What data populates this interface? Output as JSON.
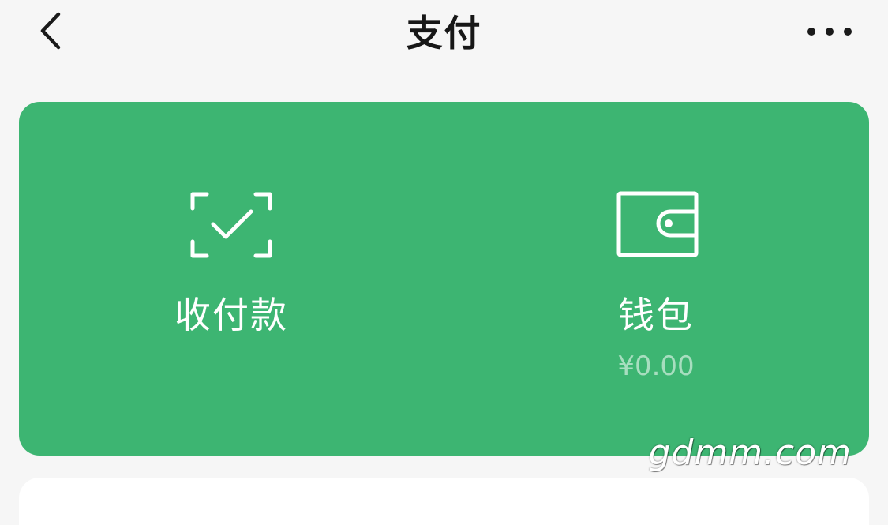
{
  "header": {
    "title": "支付",
    "back_icon": "chevron-left-icon",
    "more_icon": "more-horizontal-icon"
  },
  "pay_card": {
    "color": "#3db572",
    "items": [
      {
        "label": "收付款",
        "icon": "scan-check-icon"
      },
      {
        "label": "钱包",
        "icon": "wallet-icon",
        "balance": "¥0.00"
      }
    ]
  },
  "watermark": "gdmm.com"
}
